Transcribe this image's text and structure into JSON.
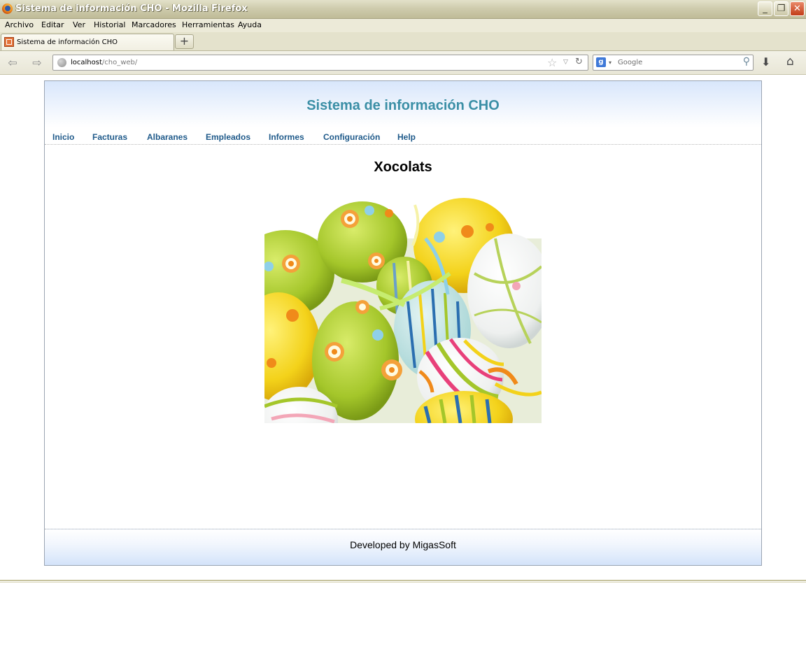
{
  "window": {
    "title": "Sistema de información CHO - Mozilla Firefox",
    "minimize_glyph": "_",
    "maximize_glyph": "❐",
    "close_glyph": "✕"
  },
  "menubar": {
    "items": [
      "Archivo",
      "Editar",
      "Ver",
      "Historial",
      "Marcadores",
      "Herramientas",
      "Ayuda"
    ]
  },
  "tabs": [
    {
      "label": "Sistema de información CHO",
      "icon": "site-favicon"
    }
  ],
  "newtab_glyph": "+",
  "navbar": {
    "back_glyph": "⇦",
    "forward_glyph": "⇨",
    "url_host": "localhost",
    "url_path": "/cho_web/",
    "bookmark_glyph": "☆",
    "dropdown_glyph": "▽",
    "reload_glyph": "↻",
    "search_engine_glyph": "g",
    "search_dropdown_glyph": "▾",
    "search_placeholder": "Google",
    "search_glyph": "⚲",
    "download_glyph": "⬇",
    "home_glyph": "⌂"
  },
  "page": {
    "site_title": "Sistema de información CHO",
    "nav": [
      "Inicio",
      "Facturas",
      "Albaranes",
      "Empleados",
      "Informes",
      "Configuración",
      "Help"
    ],
    "heading": "Xocolats",
    "image": "easter-eggs-photo",
    "footer": "Developed by MigasSoft"
  },
  "colors": {
    "site_title": "#3b8fa6",
    "nav_link": "#1f5a8a",
    "header_gradient_top": "#d8e6fb"
  }
}
